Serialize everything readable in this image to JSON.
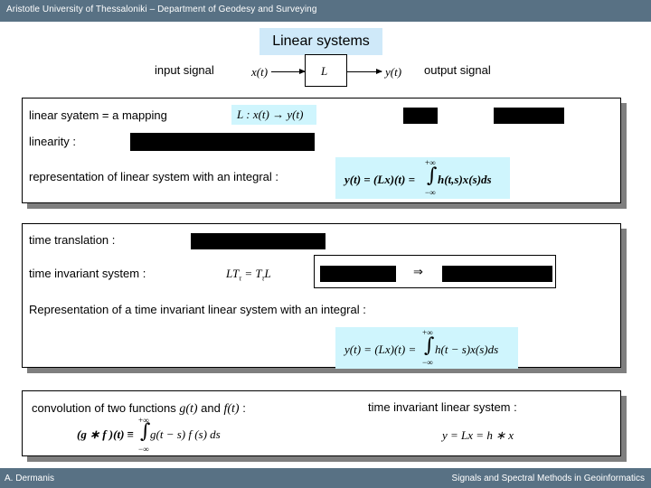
{
  "header": {
    "institution": "Aristotle University of Thessaloniki – Department of Geodesy and Surveying"
  },
  "slide": {
    "title": "Linear systems",
    "diagram": {
      "input_label": "input signal",
      "output_label": "output signal",
      "input_symbol": "x(t)",
      "system_symbol": "L",
      "output_symbol": "y(t)"
    },
    "panel1": {
      "mapping_label": "linear syatem = a mapping",
      "mapping_formula": "L : x(t) → y(t)",
      "linearity_label": "linearity :",
      "integral_label": "representation of linear system with an integral :",
      "integral_lhs": "y(t) = (Lx)(t) =",
      "integral_upper": "+∞",
      "integral_lower": "−∞",
      "integral_body": "h(t,s)x(s)ds"
    },
    "panel2": {
      "translation_label": "time translation :",
      "invariant_label": "time invariant system :",
      "invariant_formula": "LT",
      "invariant_formula_sub": "τ",
      "invariant_formula_mid": " = T",
      "invariant_formula_sub2": "τ",
      "invariant_formula_end": "L",
      "implies_symbol": "⇒",
      "ti_integral_label": "Representation of a time invariant linear system with an integral :",
      "ti_integral_lhs": "y(t) = (Lx)(t) =",
      "ti_integral_upper": "+∞",
      "ti_integral_lower": "−∞",
      "ti_integral_body": "h(t − s)x(s)ds"
    },
    "panel3": {
      "convolution_label_pre": "convolution of two functions ",
      "convolution_g": "g(t)",
      "convolution_and": " and ",
      "convolution_f": "f(t)",
      "convolution_colon": " :",
      "convolution_lhs": "(g ∗ f )(t) ≡",
      "convolution_upper": "+∞",
      "convolution_lower": "−∞",
      "convolution_body": "g(t − s) f (s) ds",
      "ti_system_label": "time invariant linear system :",
      "ti_system_formula": "y = Lx = h ∗ x"
    }
  },
  "footer": {
    "author": "A. Dermanis",
    "course": "Signals and Spectral Methods in Geoinformatics"
  }
}
